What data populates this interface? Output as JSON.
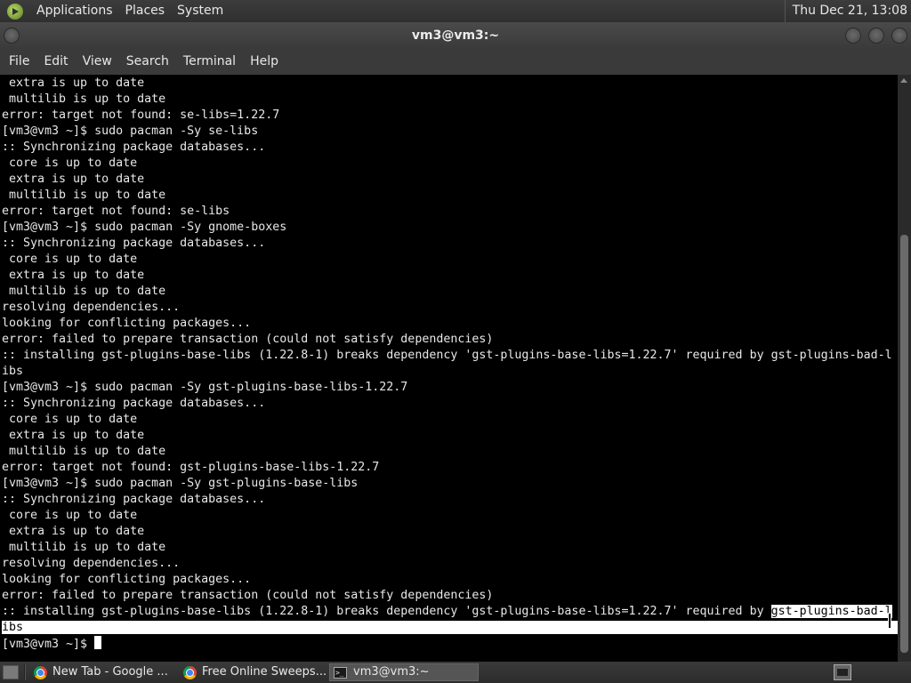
{
  "top_panel": {
    "menus": [
      "Applications",
      "Places",
      "System"
    ],
    "clock": "Thu Dec 21, 13:08"
  },
  "window": {
    "title": "vm3@vm3:~"
  },
  "menubar": {
    "items": [
      "File",
      "Edit",
      "View",
      "Search",
      "Terminal",
      "Help"
    ]
  },
  "terminal": {
    "lines": [
      " extra is up to date",
      " multilib is up to date",
      "error: target not found: se-libs=1.22.7",
      "[vm3@vm3 ~]$ sudo pacman -Sy se-libs",
      ":: Synchronizing package databases...",
      " core is up to date",
      " extra is up to date",
      " multilib is up to date",
      "error: target not found: se-libs",
      "[vm3@vm3 ~]$ sudo pacman -Sy gnome-boxes",
      ":: Synchronizing package databases...",
      " core is up to date",
      " extra is up to date",
      " multilib is up to date",
      "resolving dependencies...",
      "looking for conflicting packages...",
      "error: failed to prepare transaction (could not satisfy dependencies)",
      ":: installing gst-plugins-base-libs (1.22.8-1) breaks dependency 'gst-plugins-base-libs=1.22.7' required by gst-plugins-bad-l",
      "ibs",
      "[vm3@vm3 ~]$ sudo pacman -Sy gst-plugins-base-libs-1.22.7",
      ":: Synchronizing package databases...",
      " core is up to date",
      " extra is up to date",
      " multilib is up to date",
      "error: target not found: gst-plugins-base-libs-1.22.7",
      "[vm3@vm3 ~]$ sudo pacman -Sy gst-plugins-base-libs",
      ":: Synchronizing package databases...",
      " core is up to date",
      " extra is up to date",
      " multilib is up to date",
      "resolving dependencies...",
      "looking for conflicting packages...",
      "error: failed to prepare transaction (could not satisfy dependencies)"
    ],
    "selected_line_prefix": ":: installing gst-plugins-base-libs (1.22.8-1) breaks dependency 'gst-plugins-base-libs=1.22.7' required by ",
    "selected_line_highlight": "gst-plugins-bad-l",
    "selected_wrap": "ibs",
    "prompt": "[vm3@vm3 ~]$ "
  },
  "taskbar": {
    "tasks": [
      {
        "label": "New Tab - Google ...",
        "icon": "chrome-icon"
      },
      {
        "label": "Free Online Sweeps...",
        "icon": "chrome-icon"
      },
      {
        "label": "vm3@vm3:~",
        "icon": "terminal-icon"
      }
    ]
  },
  "colors": {
    "terminal_bg": "#000000",
    "terminal_fg": "#e8e8e8",
    "selection_bg": "#ffffff",
    "panel_bg": "#3a3a3a"
  }
}
